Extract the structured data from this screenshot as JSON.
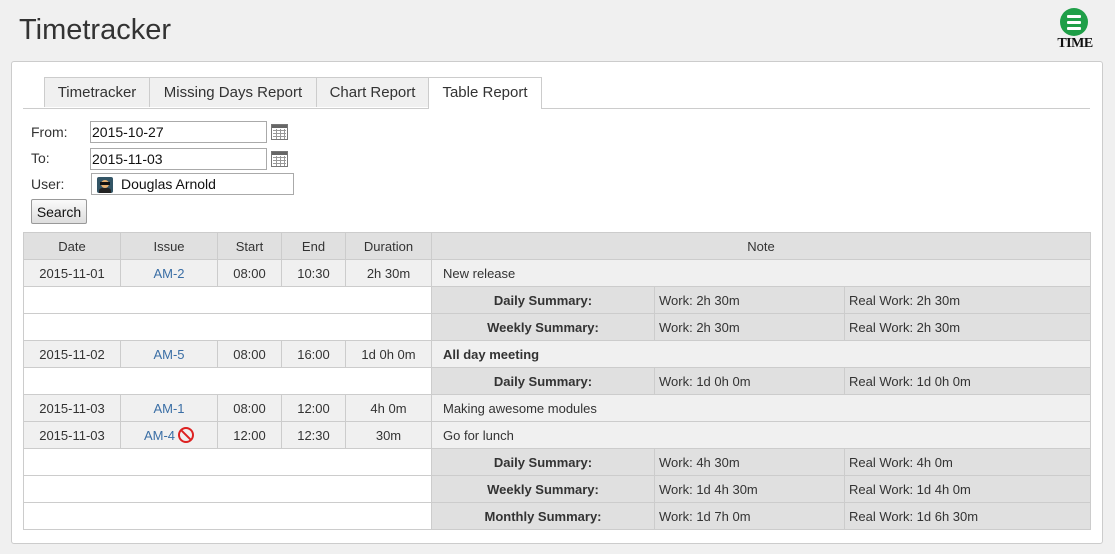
{
  "app": {
    "title": "Timetracker",
    "logo_text": "TIME"
  },
  "tabs": [
    {
      "label": "Timetracker",
      "active": false
    },
    {
      "label": "Missing Days Report",
      "active": false
    },
    {
      "label": "Chart Report",
      "active": false
    },
    {
      "label": "Table Report",
      "active": true
    }
  ],
  "form": {
    "from_label": "From:",
    "from_value": "2015-10-27",
    "to_label": "To:",
    "to_value": "2015-11-03",
    "user_label": "User:",
    "user_value": "Douglas Arnold",
    "search_label": "Search"
  },
  "table": {
    "headers": {
      "date": "Date",
      "issue": "Issue",
      "start": "Start",
      "end": "End",
      "duration": "Duration",
      "note": "Note"
    },
    "entries": [
      {
        "date": "2015-11-01",
        "issue": "AM-2",
        "start": "08:00",
        "end": "10:30",
        "duration": "2h 30m",
        "note": "New release"
      },
      {
        "date": "2015-11-02",
        "issue": "AM-5",
        "start": "08:00",
        "end": "16:00",
        "duration": "1d 0h 0m",
        "note": "All day meeting"
      },
      {
        "date": "2015-11-03",
        "issue": "AM-1",
        "start": "08:00",
        "end": "12:00",
        "duration": "4h 0m",
        "note": "Making awesome modules"
      },
      {
        "date": "2015-11-03",
        "issue": "AM-4",
        "start": "12:00",
        "end": "12:30",
        "duration": "30m",
        "note": "Go for lunch"
      }
    ],
    "summaries": [
      {
        "label": "Daily Summary:",
        "work": "Work: 2h 30m",
        "real": "Real Work: 2h 30m"
      },
      {
        "label": "Weekly Summary:",
        "work": "Work: 2h 30m",
        "real": "Real Work: 2h 30m"
      },
      {
        "label": "Daily Summary:",
        "work": "Work: 1d 0h 0m",
        "real": "Real Work: 1d 0h 0m"
      },
      {
        "label": "Daily Summary:",
        "work": "Work: 4h 30m",
        "real": "Real Work: 4h 0m"
      },
      {
        "label": "Weekly Summary:",
        "work": "Work: 1d 4h 30m",
        "real": "Real Work: 1d 4h 0m"
      },
      {
        "label": "Monthly Summary:",
        "work": "Work: 1d 7h 0m",
        "real": "Real Work: 1d 6h 30m"
      }
    ]
  },
  "colors": {
    "link": "#3a6ea5",
    "logo_green": "#1f9f48",
    "blocked_red": "#d22"
  }
}
